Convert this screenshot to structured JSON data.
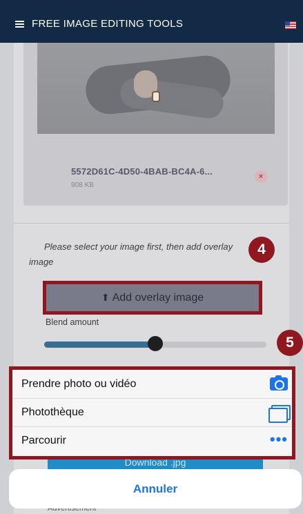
{
  "topbar": {
    "title": "FREE IMAGE EDITING TOOLS",
    "menu_icon": "hamburger-menu-icon",
    "flag_icon": "us-flag-icon"
  },
  "uploaded_file": {
    "name": "5572D61C-4D50-4BAB-BC4A-6...",
    "size": "908 KB"
  },
  "overlay": {
    "instruction": "Please select your image first, then add overlay image",
    "button_label": "Add overlay image"
  },
  "blend": {
    "label": "Blend amount",
    "value_fraction": 0.5
  },
  "steps": {
    "step_4": "4",
    "step_5": "5"
  },
  "action_sheet": {
    "options": [
      {
        "label": "Prendre photo ou vidéo",
        "icon": "camera-icon"
      },
      {
        "label": "Photothèque",
        "icon": "photo-library-icon"
      },
      {
        "label": "Parcourir",
        "icon": "more-dots-icon",
        "glyph": "•••"
      }
    ],
    "cancel_label": "Annuler"
  },
  "background_peek": {
    "download_label": "Download .jpg",
    "ad_label": "Advertisement"
  },
  "colors": {
    "topbar": "#132a47",
    "highlight": "#8e1720",
    "ios_blue": "#1d74e8",
    "slider_fill": "#3a6d92"
  }
}
